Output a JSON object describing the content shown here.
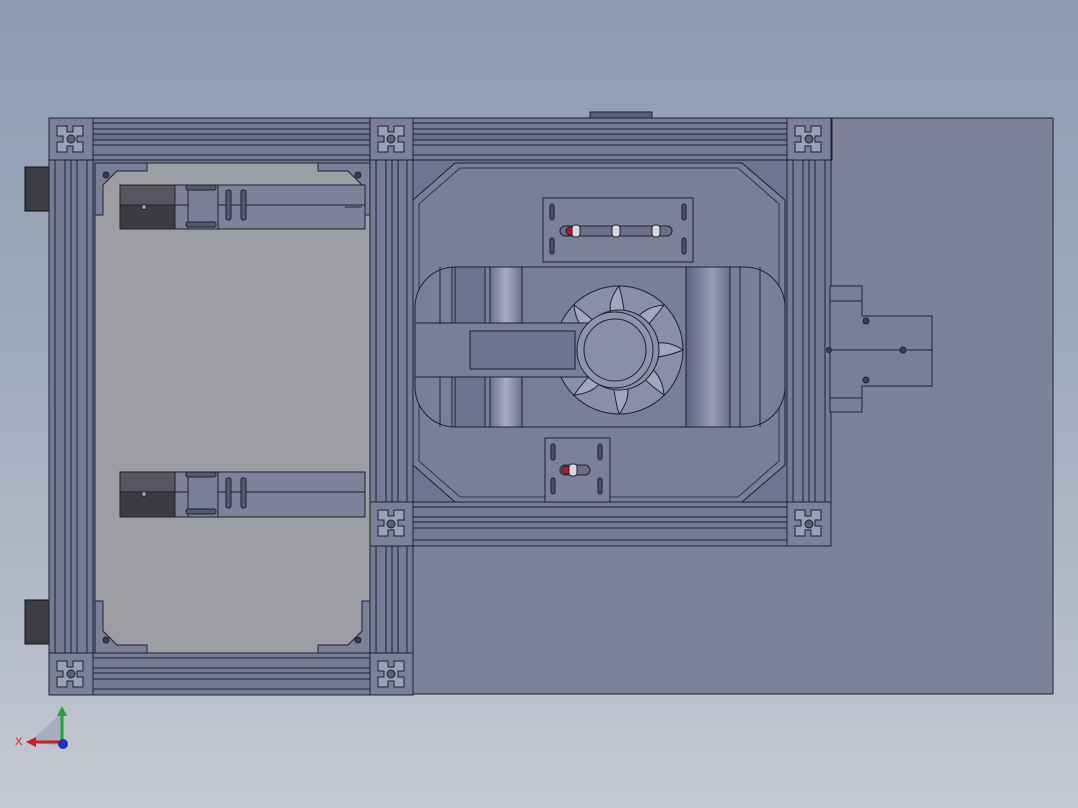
{
  "viewport": {
    "background_top": "#8d9cb0",
    "background_bottom": "#c6cad3"
  },
  "model": {
    "body_color": "#6f7691",
    "plate_color": "#7d8198",
    "panel_color": "#9d9ea3",
    "edge_color": "#1e2130",
    "accent_red": "#b01c22"
  },
  "triad": {
    "x_label": "X",
    "x_color": "#c0232b",
    "y_color": "#23a23a",
    "z_color": "#2233b8"
  }
}
